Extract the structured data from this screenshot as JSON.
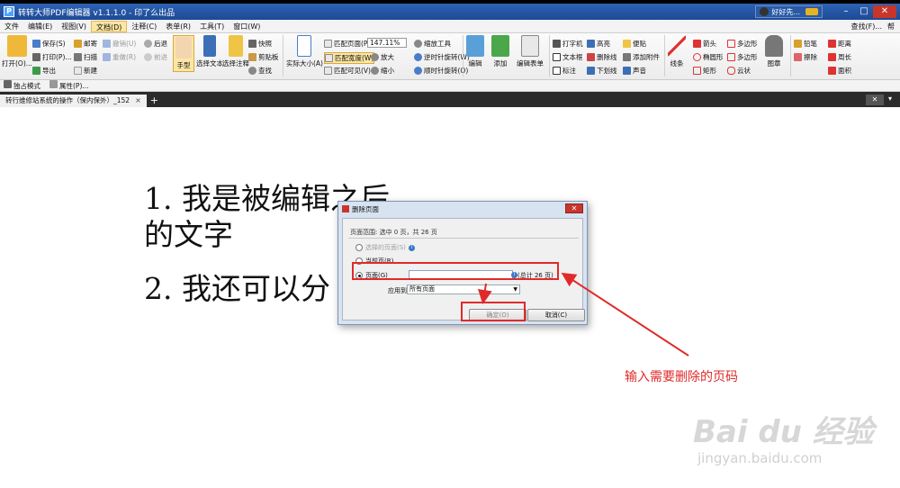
{
  "titlebar": {
    "title": "转转大师PDF编辑器 v1.1.1.0 - 印了么出品",
    "user": "好好先...",
    "minimize": "–",
    "maximize": "□",
    "close": "✕"
  },
  "menubar": {
    "items": [
      "文件",
      "编辑(E)",
      "视图(V)",
      "文档(D)",
      "注释(C)",
      "表单(R)",
      "工具(T)",
      "窗口(W)"
    ],
    "active_index": 3,
    "right": [
      "查找(F)...",
      "帮"
    ]
  },
  "ribbon": {
    "open": "打开(O)...",
    "save": "保存(S)",
    "print": "打印(P)...",
    "export": "导出",
    "mail": "邮寄",
    "scan": "扫描",
    "new": "新建",
    "undo": "撤销(U)",
    "redo": "重做(R)",
    "back": "后退",
    "forward": "前进",
    "hand": "手型",
    "select_text": "选择文本",
    "select_annot": "选择注释",
    "snapshot": "快照",
    "clipboard": "剪贴板",
    "find": "查找",
    "actual_size": "实际大小(A)",
    "fit_page": "匹配页面(P)",
    "fit_width": "匹配宽度(W)",
    "fit_visible": "匹配可见(V)",
    "zoom": "147.11%",
    "zoom_tool": "缩放工具",
    "zoom_in": "放大",
    "zoom_out": "缩小",
    "rotate_ccw": "逆时针旋转(W)",
    "rotate_cw": "顺时针旋转(O)",
    "edit": "编辑",
    "add": "添加",
    "edit_form": "编辑表单",
    "typewriter": "打字机",
    "textbox": "文本框",
    "label": "标注",
    "highlight": "高亮",
    "strikeout": "删除线",
    "underline": "下划线",
    "note": "便贴",
    "attach": "添加附件",
    "sound": "声音",
    "line": "线条",
    "arrow": "箭头",
    "ellipse": "椭圆形",
    "rect": "矩形",
    "polygon": "多边形",
    "polyline": "多边形",
    "cloud": "云状",
    "stamp": "图章",
    "pencil": "铅笔",
    "eraser": "擦除",
    "distance": "距离",
    "perimeter": "周长",
    "area": "面积"
  },
  "quickbar": {
    "exclusive": "独占模式",
    "properties": "属性(P)..."
  },
  "tab": {
    "label": "转行维修站系统的操作（保内保外）_152",
    "close": "×",
    "add": "+",
    "close_all": "✕"
  },
  "document": {
    "line1": "1. 我是被编辑之后",
    "line2": "的文字",
    "line3": "2. 我还可以分"
  },
  "dialog": {
    "title": "删除页面",
    "close": "✕",
    "range_text": "页面范围: 选中 0 页，共 26 页",
    "opt_selected": "选择的页面(S)",
    "opt_current": "当前页(R)",
    "opt_pages": "页面(G)",
    "pages_value": "",
    "total": "(总计 26 页)",
    "apply_label": "应用到",
    "apply_value": "所有页面",
    "ok": "确定(O)",
    "cancel": "取消(C)"
  },
  "annotation": {
    "text": "输入需要删除的页码"
  },
  "watermark": {
    "brand": "Bai du 经验",
    "url": "jingyan.baidu.com"
  },
  "colors": {
    "accent": "#2d62b3",
    "annot_red": "#e02a2a",
    "selected": "#fde6a4"
  }
}
